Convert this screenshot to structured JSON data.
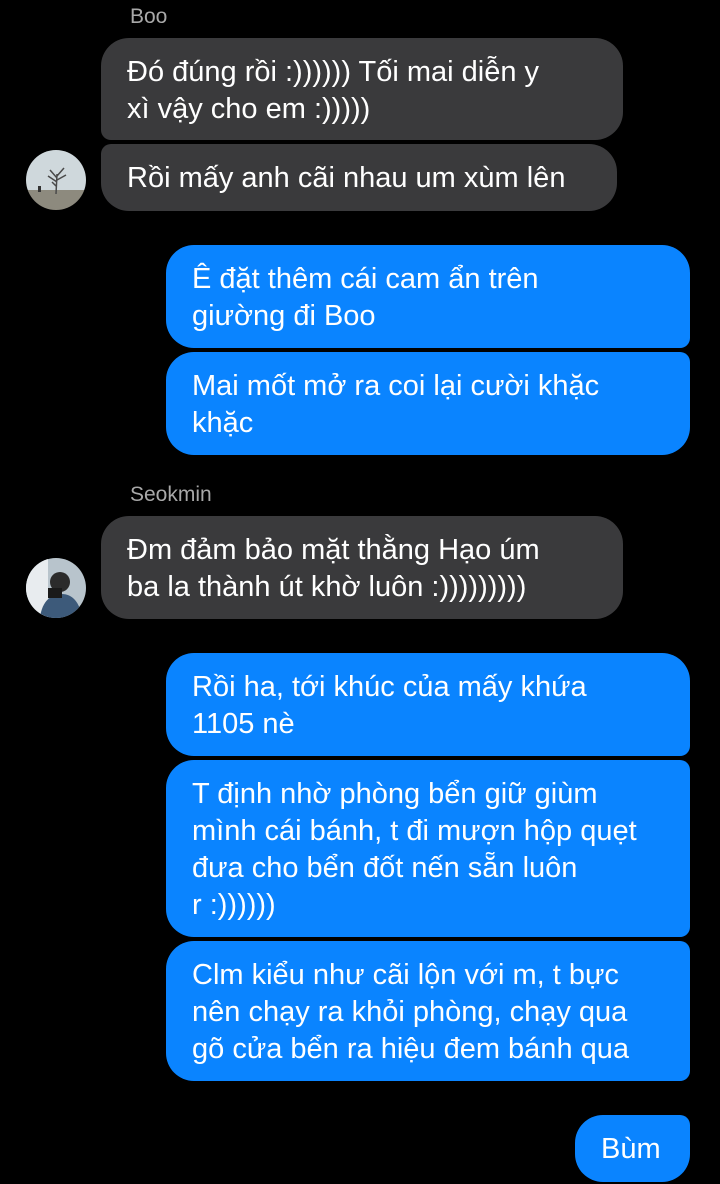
{
  "colors": {
    "background": "#000000",
    "incoming_bubble": "#3a3a3c",
    "outgoing_bubble": "#0a84ff",
    "sender_name": "#a8a8a8",
    "text": "#ffffff"
  },
  "groups": [
    {
      "sender": "Boo",
      "avatar_icon": "tree-landscape-avatar-icon",
      "messages": [
        "Đó đúng rồi :)))))) Tối mai diễn y\nxì vậy cho em :)))))",
        "Rồi mấy anh cãi nhau um xùm lên"
      ]
    },
    {
      "sender": "me",
      "messages": [
        "Ê đặt thêm cái cam ẩn trên\ngiường đi Boo",
        "Mai mốt mở ra coi lại cười khặc\nkhặc"
      ]
    },
    {
      "sender": "Seokmin",
      "avatar_icon": "person-photo-avatar-icon",
      "messages": [
        "Đm đảm bảo mặt thằng Hạo úm\nba la thành út khờ luôn :)))))))))"
      ]
    },
    {
      "sender": "me",
      "messages": [
        "Rồi ha, tới khúc của mấy khứa\n1105 nè",
        "T định nhờ phòng bển giữ giùm\nmình cái bánh, t đi mượn hộp quẹt\nđưa cho bển đốt nến sẵn luôn\nr :))))))",
        "Clm kiểu như cãi lộn với m, t bực\nnên chạy ra khỏi phòng, chạy qua\ngõ cửa bển ra hiệu đem bánh qua",
        "Bùm"
      ]
    }
  ]
}
